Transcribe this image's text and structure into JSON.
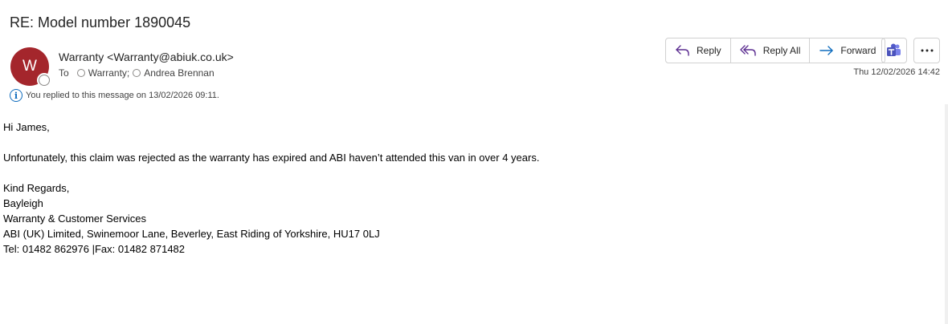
{
  "subject": "RE: Model number 1890045",
  "sender": {
    "initial": "W",
    "display": "Warranty <Warranty@abiuk.co.uk>",
    "avatar_color": "#a4262c"
  },
  "to": {
    "label": "To",
    "recipients": [
      "Warranty;",
      "Andrea Brennan"
    ]
  },
  "info": {
    "icon": "info-icon",
    "text": "You replied to this message on 13/02/2026 09:11."
  },
  "actions": {
    "reply": "Reply",
    "reply_all": "Reply All",
    "forward": "Forward",
    "teams_icon": "teams-icon",
    "more_icon": "more-icon"
  },
  "date": "Thu 12/02/2026 14:42",
  "body": {
    "greeting": "Hi James,",
    "message": "Unfortunately, this claim was rejected as the warranty has expired and ABI haven’t attended this van in over 4 years.",
    "sign_off": "Kind Regards,",
    "name": "Bayleigh",
    "department": "Warranty & Customer Services",
    "address": "ABI (UK) Limited, Swinemoor Lane, Beverley, East Riding of Yorkshire, HU17 0LJ",
    "phone": "Tel: 01482 862976 |Fax: 01482 871482"
  }
}
